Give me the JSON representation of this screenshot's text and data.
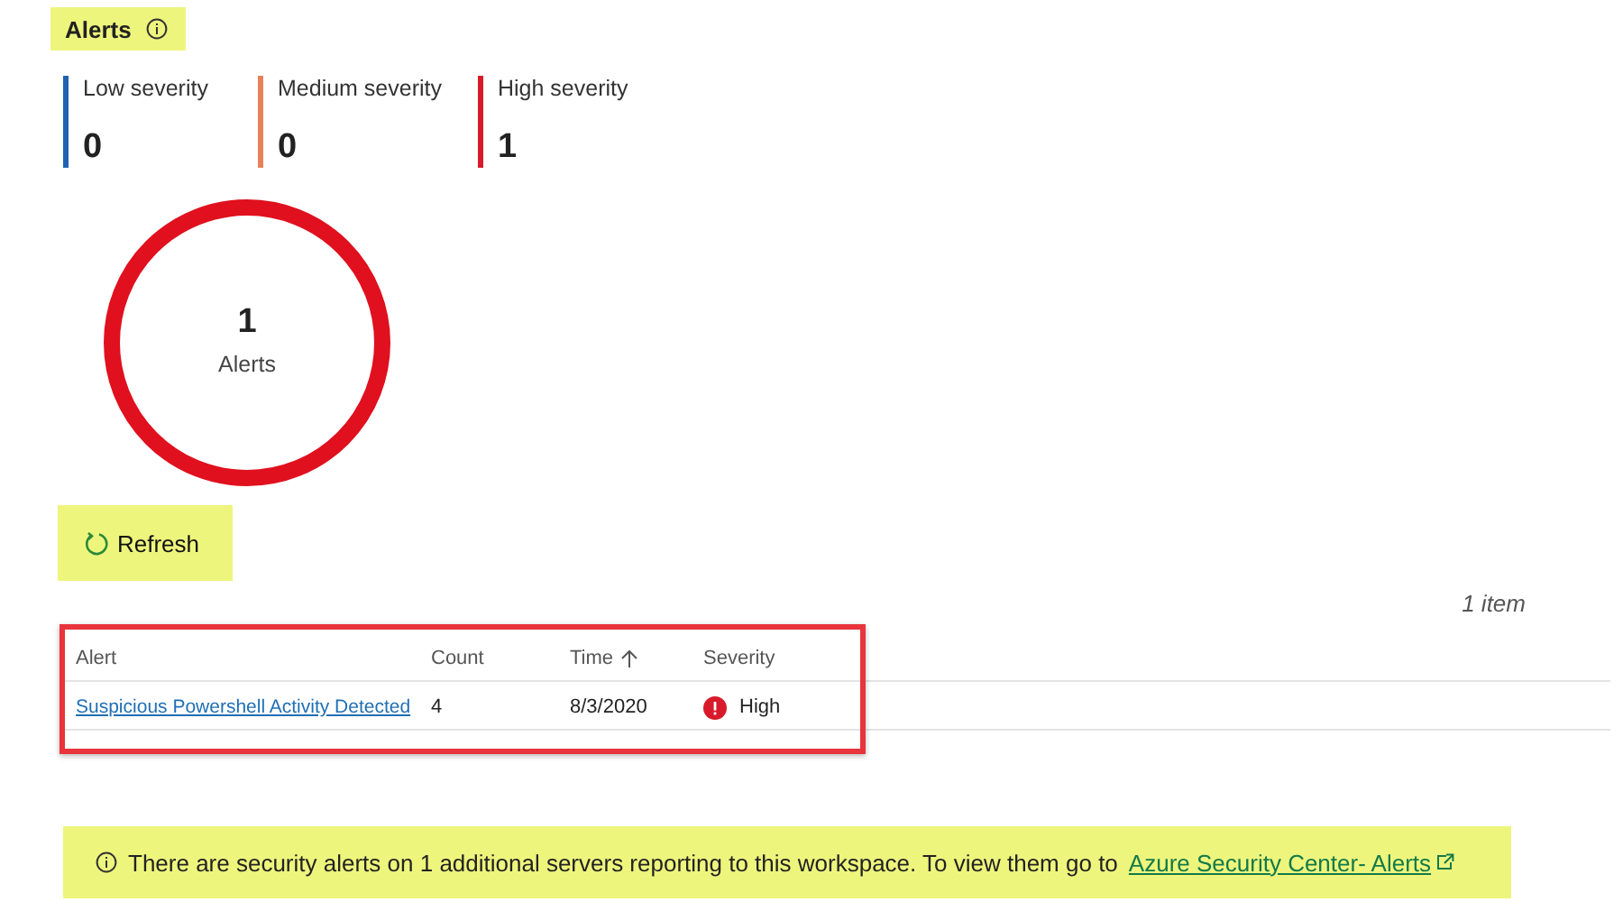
{
  "title": "Alerts",
  "severities": [
    {
      "label": "Low severity",
      "count": "0",
      "color": "#1f62b0"
    },
    {
      "label": "Medium severity",
      "count": "0",
      "color": "#e8805a"
    },
    {
      "label": "High severity",
      "count": "1",
      "color": "#d91a2a"
    }
  ],
  "donut": {
    "value": "1",
    "label": "Alerts",
    "color": "#e0101e"
  },
  "refresh": "Refresh",
  "item_count": "1 item",
  "table": {
    "columns": [
      {
        "label": "Alert",
        "sorted": false
      },
      {
        "label": "Count",
        "sorted": false
      },
      {
        "label": "Time",
        "sorted": true
      },
      {
        "label": "Severity",
        "sorted": false
      }
    ],
    "rows": [
      {
        "alert": "Suspicious Powershell Activity Detected",
        "count": "4",
        "time": "8/3/2020",
        "severity": "High",
        "color": "#d91a2a"
      }
    ]
  },
  "banner": {
    "text": "There are security alerts on 1 additional servers reporting to this workspace. To view them go to",
    "link": "Azure Security Center- Alerts"
  }
}
